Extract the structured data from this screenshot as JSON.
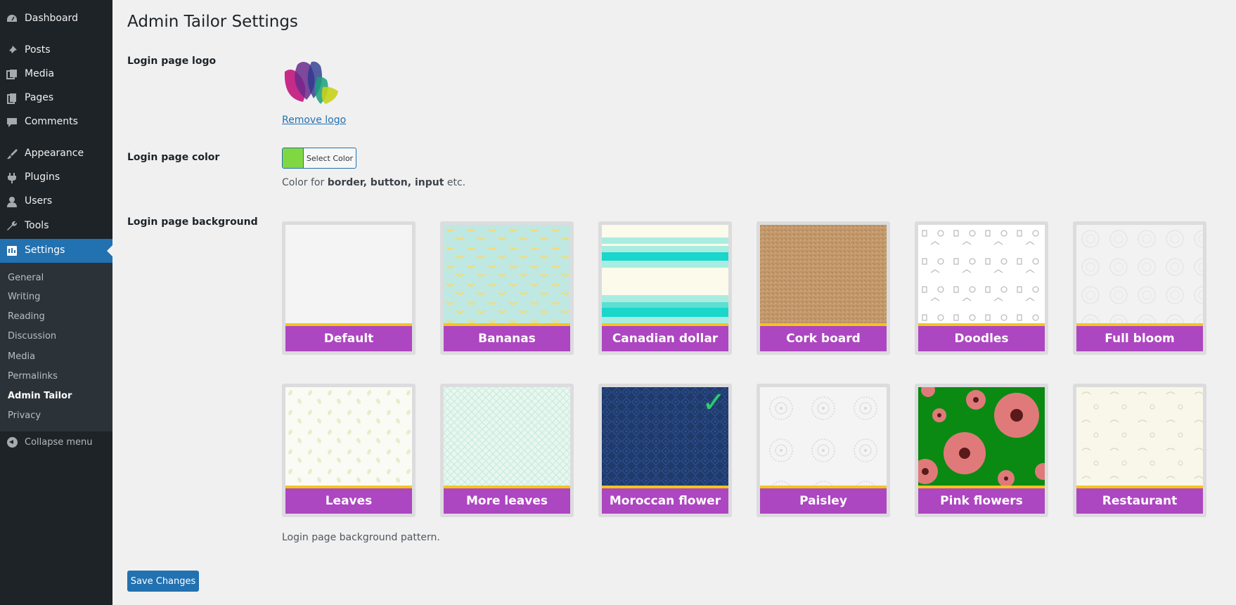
{
  "sidebar": {
    "menu": [
      {
        "label": "Dashboard",
        "icon": "dashboard-icon"
      },
      {
        "label": "Posts",
        "icon": "pin-icon"
      },
      {
        "label": "Media",
        "icon": "media-icon"
      },
      {
        "label": "Pages",
        "icon": "pages-icon"
      },
      {
        "label": "Comments",
        "icon": "comment-icon"
      },
      {
        "label": "Appearance",
        "icon": "paintbrush-icon"
      },
      {
        "label": "Plugins",
        "icon": "plugin-icon"
      },
      {
        "label": "Users",
        "icon": "user-icon"
      },
      {
        "label": "Tools",
        "icon": "wrench-icon"
      },
      {
        "label": "Settings",
        "icon": "settings-icon",
        "current": true
      }
    ],
    "submenu": [
      "General",
      "Writing",
      "Reading",
      "Discussion",
      "Media",
      "Permalinks",
      "Admin Tailor",
      "Privacy"
    ],
    "submenu_current": "Admin Tailor",
    "collapse_label": "Collapse menu"
  },
  "page": {
    "title": "Admin Tailor Settings",
    "logo_label": "Login page logo",
    "remove_logo": "Remove logo",
    "color_label": "Login page color",
    "select_color": "Select Color",
    "selected_color": "#81d742",
    "color_desc_prefix": "Color for ",
    "color_desc_bold": "border, button, input",
    "color_desc_suffix": " etc.",
    "background_label": "Login page background",
    "background_desc": "Login page background pattern.",
    "save_label": "Save Changes"
  },
  "patterns": [
    {
      "name": "Default",
      "selected": false
    },
    {
      "name": "Bananas",
      "selected": false
    },
    {
      "name": "Canadian dollar",
      "selected": false
    },
    {
      "name": "Cork board",
      "selected": false
    },
    {
      "name": "Doodles",
      "selected": false
    },
    {
      "name": "Full bloom",
      "selected": false
    },
    {
      "name": "Leaves",
      "selected": false
    },
    {
      "name": "More leaves",
      "selected": false
    },
    {
      "name": "Moroccan flower",
      "selected": true
    },
    {
      "name": "Paisley",
      "selected": false
    },
    {
      "name": "Pink flowers",
      "selected": false
    },
    {
      "name": "Restaurant",
      "selected": false
    }
  ],
  "colors": {
    "sidebar_bg": "#1d2327",
    "accent": "#2271b1",
    "tile_label_bg": "#ad46c1",
    "tile_bar": "#f5c518"
  }
}
